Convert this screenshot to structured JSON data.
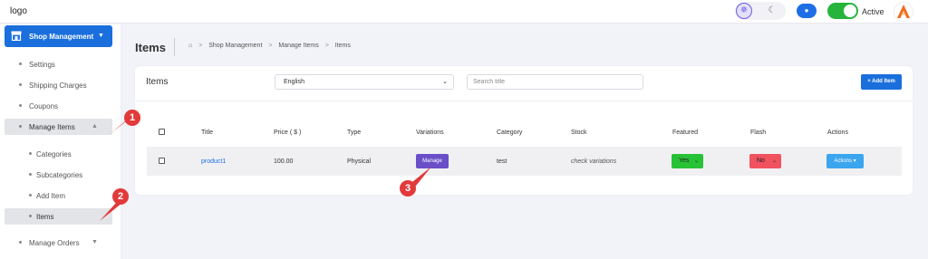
{
  "topbar": {
    "logo": "logo",
    "theme_light_icon": "sun-icon",
    "theme_dark_icon": "moon-icon",
    "preview_icon": "eye-icon",
    "active_label": "Active",
    "active_on": true
  },
  "sidebar": {
    "header": "Shop Management",
    "items": [
      {
        "label": "Settings"
      },
      {
        "label": "Shipping Charges"
      },
      {
        "label": "Coupons"
      },
      {
        "label": "Manage Items"
      },
      {
        "label": "Categories"
      },
      {
        "label": "Subcategories"
      },
      {
        "label": "Add Item"
      },
      {
        "label": "Items"
      },
      {
        "label": "Manage Orders"
      }
    ]
  },
  "page": {
    "title": "Items",
    "breadcrumb": [
      "Shop Management",
      "Manage Items",
      "Items"
    ]
  },
  "card": {
    "title": "Items",
    "language": "English",
    "search_placeholder": "Search title",
    "add_button": "+ Add Item"
  },
  "table": {
    "headers": [
      "Title",
      "Price ( $ )",
      "Type",
      "Variations",
      "Category",
      "Stock",
      "Featured",
      "Flash",
      "Actions"
    ],
    "rows": [
      {
        "title": "product1",
        "price": "100.00",
        "type": "Physical",
        "variations": "Manage",
        "category": "test",
        "stock": "check variations",
        "featured": "Yes",
        "flash": "No",
        "actions": "Actions"
      }
    ]
  },
  "markers": [
    "1",
    "2",
    "3"
  ],
  "colors": {
    "primary": "#1a6fdc",
    "manage": "#6a4fc9",
    "featured_yes": "#27c236",
    "flash_no": "#f0525f",
    "actions": "#3ba5ef",
    "marker": "#e2393a"
  }
}
